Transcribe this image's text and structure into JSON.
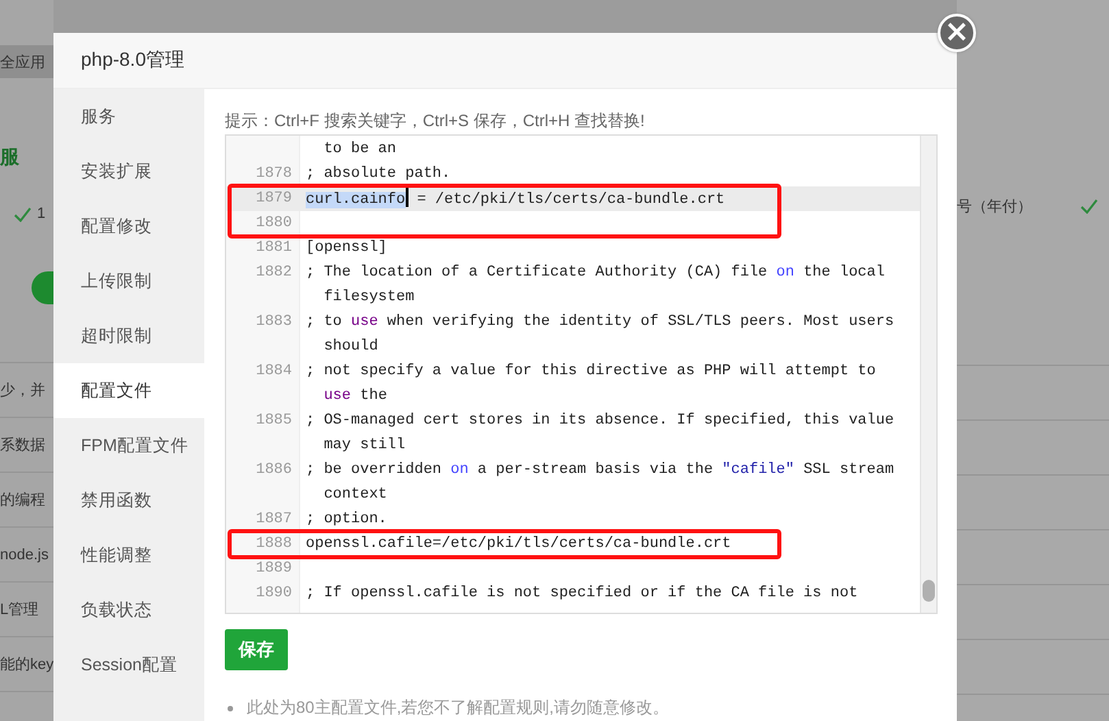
{
  "background": {
    "left_texts": [
      "全应用",
      "服",
      "1",
      "少，并",
      "系数据",
      "的编程",
      "node.js",
      "L管理",
      "能的key"
    ],
    "right_texts": [
      "号（年付）"
    ]
  },
  "dialog": {
    "title": "php-8.0管理",
    "close_icon": "×",
    "sidebar": {
      "items": [
        {
          "label": "服务",
          "selected": false
        },
        {
          "label": "安装扩展",
          "selected": false
        },
        {
          "label": "配置修改",
          "selected": false
        },
        {
          "label": "上传限制",
          "selected": false
        },
        {
          "label": "超时限制",
          "selected": false
        },
        {
          "label": "配置文件",
          "selected": true
        },
        {
          "label": "FPM配置文件",
          "selected": false
        },
        {
          "label": "禁用函数",
          "selected": false
        },
        {
          "label": "性能调整",
          "selected": false
        },
        {
          "label": "负载状态",
          "selected": false
        },
        {
          "label": "Session配置",
          "selected": false
        }
      ]
    },
    "tip": "提示：Ctrl+F 搜索关键字，Ctrl+S 保存，Ctrl+H 查找替换!",
    "editor": {
      "lines": [
        {
          "active": false,
          "boxed": false,
          "rows": [
            "  to be an"
          ]
        },
        {
          "number": "1878",
          "active": false,
          "boxed": false,
          "rows": [
            "; absolute path."
          ]
        },
        {
          "number": "1879",
          "active": true,
          "boxed": true,
          "rows": [
            [
              {
                "text": "curl.cainfo",
                "kind": "selection"
              },
              {
                "text": " = /etc/pki/tls/certs/ca-bundle.crt",
                "kind": "plain"
              }
            ]
          ]
        },
        {
          "number": "1880",
          "active": false,
          "boxed": true,
          "rows": [
            ""
          ]
        },
        {
          "number": "1881",
          "active": false,
          "boxed": false,
          "rows": [
            "[openssl]"
          ]
        },
        {
          "number": "1882",
          "active": false,
          "boxed": false,
          "rows": [
            [
              {
                "text": "; The location of a Certificate Authority (CA) file ",
                "kind": "plain"
              },
              {
                "text": "on",
                "kind": "atom"
              },
              {
                "text": " the local",
                "kind": "plain"
              }
            ],
            "  filesystem"
          ]
        },
        {
          "number": "1883",
          "active": false,
          "boxed": false,
          "rows": [
            [
              {
                "text": "; to ",
                "kind": "plain"
              },
              {
                "text": "use",
                "kind": "keyword"
              },
              {
                "text": " when verifying the identity of SSL/TLS peers. Most users",
                "kind": "plain"
              }
            ],
            "  should"
          ]
        },
        {
          "number": "1884",
          "active": false,
          "boxed": false,
          "rows": [
            "; not specify a value for this directive as PHP will attempt to",
            [
              {
                "text": "  ",
                "kind": "plain"
              },
              {
                "text": "use",
                "kind": "keyword"
              },
              {
                "text": " the",
                "kind": "plain"
              }
            ]
          ]
        },
        {
          "number": "1885",
          "active": false,
          "boxed": false,
          "rows": [
            "; OS-managed cert stores in its absence. If specified, this value",
            "  may still"
          ]
        },
        {
          "number": "1886",
          "active": false,
          "boxed": false,
          "rows": [
            [
              {
                "text": "; be overridden ",
                "kind": "plain"
              },
              {
                "text": "on",
                "kind": "atom"
              },
              {
                "text": " a per-stream basis via the ",
                "kind": "plain"
              },
              {
                "text": "\"cafile\"",
                "kind": "string"
              },
              {
                "text": " SSL stream",
                "kind": "plain"
              }
            ],
            "  context"
          ]
        },
        {
          "number": "1887",
          "active": false,
          "boxed": false,
          "rows": [
            "; option."
          ]
        },
        {
          "number": "1888",
          "active": false,
          "boxed": true,
          "rows": [
            "openssl.cafile=/etc/pki/tls/certs/ca-bundle.crt"
          ]
        },
        {
          "number": "1889",
          "active": false,
          "boxed": false,
          "rows": [
            ""
          ]
        },
        {
          "number": "1890",
          "active": false,
          "boxed": false,
          "rows": [
            "; If openssl.cafile is not specified or if the CA file is not"
          ]
        }
      ]
    },
    "save_button": "保存",
    "notes": [
      "此处为80主配置文件,若您不了解配置规则,请勿随意修改。"
    ]
  }
}
